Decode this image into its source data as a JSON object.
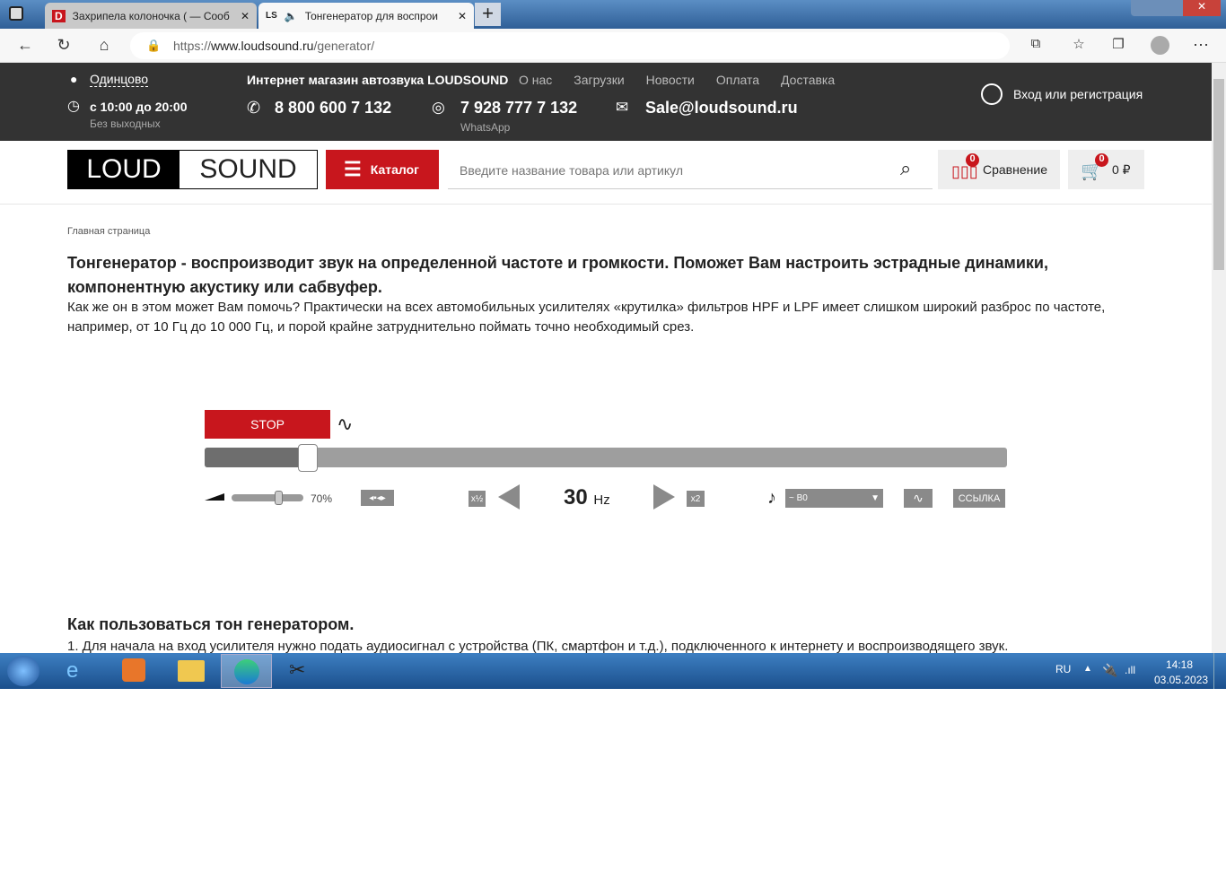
{
  "browser": {
    "tabs": [
      {
        "label": "Захрипела колоночка ( — Сооб",
        "favicon": "D"
      },
      {
        "label": "Тонгенератор для воспрои",
        "favicon": "LS"
      }
    ],
    "url_prefix": "https://",
    "url_host": "www.loudsound.ru",
    "url_path": "/generator/"
  },
  "header": {
    "city": "Одинцово",
    "hours": "с 10:00 до 20:00",
    "days": "Без выходных",
    "shop_title": "Интернет магазин автозвука LOUDSOUND",
    "links": [
      "О нас",
      "Загрузки",
      "Новости",
      "Оплата",
      "Доставка"
    ],
    "phone": "8 800 600 7 132",
    "whatsapp": "7 928 777 7 132",
    "whatsapp_label": "WhatsApp",
    "email": "Sale@loudsound.ru",
    "login": "Вход или регистрация"
  },
  "nav": {
    "logo_left": "LOUD",
    "logo_right": "SOUND",
    "catalog": "Каталог",
    "search_placeholder": "Введите название товара или артикул",
    "compare": "Сравнение",
    "compare_count": "0",
    "cart_count": "0",
    "cart_total": "0 ₽"
  },
  "content": {
    "breadcrumb": "Главная страница",
    "heading": "Тонгенератор - воспроизводит звук на определенной частоте и громкости. Поможет Вам настроить эстрадные динамики, компонентную акустику или сабвуфер.",
    "intro": "Как же он в этом может Вам помочь? Практически на всех автомобильных усилителях «крутилка» фильтров HPF и LPF имеет слишком широкий разброс по частоте, например, от 10 Гц до 10 000 Гц, и порой крайне затруднительно поймать точно необходимый срез.",
    "howto_title": "Как пользоваться тон генератором.",
    "howto_1": "1. Для начала на вход усилителя нужно подать аудиосигнал с устройства (ПК, смартфон и т.д.), подключенного к интернету и воспроизводящего звук."
  },
  "generator": {
    "stop": "STOP",
    "volume": "70%",
    "volume_fraction": 0.7,
    "half": "x½",
    "double": "x2",
    "freq": "30",
    "unit": "Hz",
    "note": "~ B0",
    "link": "ССЫЛКА",
    "freq_slider_fraction": 0.13,
    "accent": "#c8161d"
  },
  "taskbar": {
    "lang": "RU",
    "time": "14:18",
    "date": "03.05.2023"
  }
}
